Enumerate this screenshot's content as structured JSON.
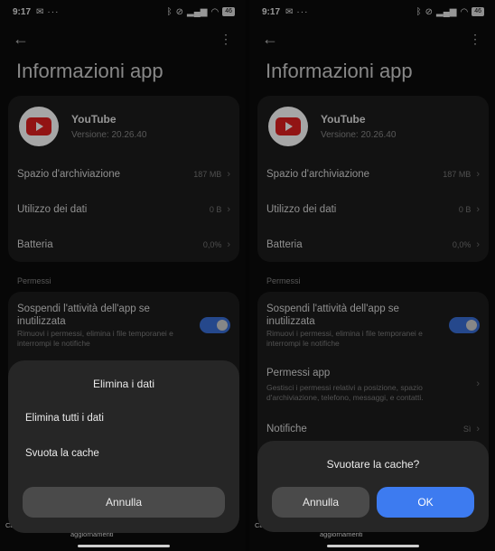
{
  "status": {
    "time": "9:17",
    "battery": "46"
  },
  "header": {
    "title": "Informazioni app"
  },
  "app": {
    "name": "YouTube",
    "version": "Versione: 20.26.40"
  },
  "rows": [
    {
      "label": "Spazio d'archiviazione",
      "value": "187 MB"
    },
    {
      "label": "Utilizzo dei dati",
      "value": "0 B"
    },
    {
      "label": "Batteria",
      "value": "0,0%"
    }
  ],
  "permissions": {
    "section": "Permessi",
    "suspend_title": "Sospendi l'attività dell'app se inutilizzata",
    "suspend_desc": "Rimuovi i permessi, elimina i file temporanei e interrompi le notifiche",
    "suspend_enabled": true,
    "app_perms_title": "Permessi app",
    "app_perms_desc": "Gestisci i permessi relativi a posizione, spazio d'archiviazione, telefono, messaggi, e contatti.",
    "notifications_label": "Notifiche",
    "notifications_value": "Sì"
  },
  "bottom": {
    "partial_text": "aggiornamenti",
    "partial_left": "Ca"
  },
  "left_dialog": {
    "title": "Elimina i dati",
    "items": [
      "Elimina tutti i dati",
      "Svuota la cache"
    ],
    "cancel": "Annulla"
  },
  "right_dialog": {
    "title": "Svuotare la cache?",
    "cancel": "Annulla",
    "ok": "OK"
  },
  "colors": {
    "accent": "#3d7bf0",
    "toggle": "#3a6fd8",
    "youtube_red": "#e02020"
  },
  "icons": {
    "back": "arrow-left-icon",
    "menu": "more-vertical-icon"
  }
}
